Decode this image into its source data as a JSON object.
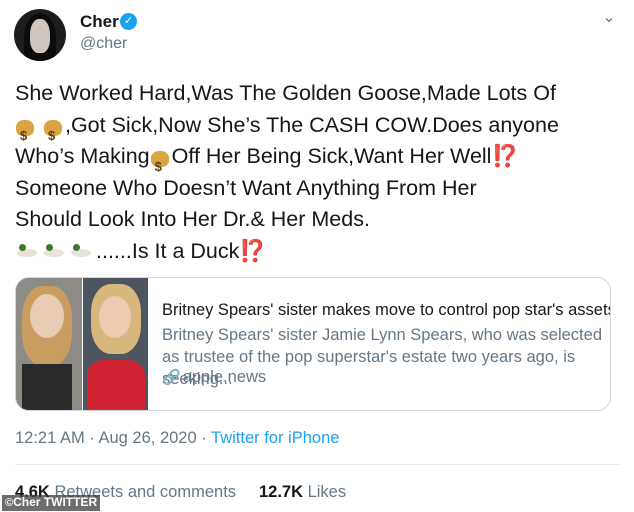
{
  "author": {
    "name": "Cher",
    "handle": "@cher"
  },
  "icons": {
    "verified": "verified-badge-icon",
    "menu": "chevron-down-icon",
    "money": "money-bag-emoji",
    "bang": "exclamation-question-emoji",
    "duck": "duck-emoji",
    "link": "link-icon"
  },
  "tweet": {
    "line1": "She Worked Hard,Was The Golden Goose,Made Lots Of",
    "line2_after": ",Got Sick,Now She’s The CASH COW.Does anyone",
    "line3_before": "Who’s Making",
    "line3_after": "Off Her Being Sick,Want Her Well",
    "line4": "Someone Who Doesn’t Want Anything From Her",
    "line5": "Should Look Into Her Dr.& Her Meds.",
    "line6_after": "......Is It a Duck",
    "bang": "⁉️"
  },
  "card": {
    "title": "Britney Spears' sister makes move to control pop star's assets",
    "description": "Britney Spears' sister Jamie Lynn Spears, who was selected as trustee of the pop superstar's estate two years ago, is seeking...",
    "link": "apple.news"
  },
  "meta": {
    "time": "12:21 AM",
    "separator": " · ",
    "date": "Aug 26, 2020",
    "app": "Twitter for iPhone"
  },
  "stats": {
    "retweets_count": "4.6K",
    "retweets_label": "Retweets and comments",
    "likes_count": "12.7K",
    "likes_label": "Likes"
  },
  "watermark": "Cher TWITTER",
  "colors": {
    "link_blue": "#1da1f2",
    "muted": "#657786",
    "text": "#14171a",
    "bang_red": "#d72a3f"
  }
}
